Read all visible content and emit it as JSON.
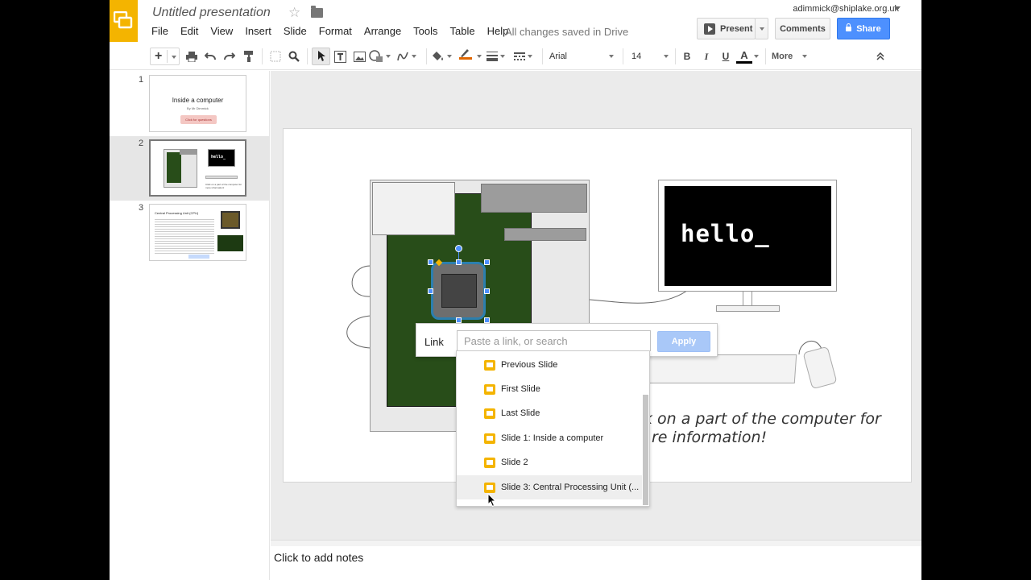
{
  "header": {
    "title": "Untitled presentation",
    "menu": [
      "File",
      "Edit",
      "View",
      "Insert",
      "Slide",
      "Format",
      "Arrange",
      "Tools",
      "Table",
      "Help"
    ],
    "save_status": "All changes saved in Drive",
    "account": "adimmick@shiplake.org.uk",
    "present_label": "Present",
    "comments_label": "Comments",
    "share_label": "Share"
  },
  "toolbar": {
    "add_label": "+",
    "font_name": "Arial",
    "font_size": "14",
    "bold": "B",
    "italic": "I",
    "underline": "U",
    "text_color": "A",
    "more_label": "More",
    "text_color_bar": "#e06600"
  },
  "filmstrip": {
    "slides": [
      {
        "number": "1",
        "title": "Inside a computer",
        "subtitle": "By Mr Dimmick",
        "button": "Click for questions"
      },
      {
        "number": "2",
        "screen_text": "hello_",
        "caption": "Click on a part of the computer for more information!"
      },
      {
        "number": "3",
        "title": "Central Processing Unit (CPU)"
      }
    ]
  },
  "slide": {
    "screen_text": "hello_",
    "hint_line1": "k on a part of the computer for",
    "hint_line2": "re information!"
  },
  "link_popup": {
    "label": "Link",
    "placeholder": "Paste a link, or search",
    "apply_label": "Apply",
    "options": [
      "Previous Slide",
      "First Slide",
      "Last Slide",
      "Slide 1: Inside a computer",
      "Slide 2",
      "Slide 3: Central Processing Unit (..."
    ]
  },
  "notes": {
    "placeholder": "Click to add notes"
  },
  "colors": {
    "brand": "#f4b400",
    "share": "#4d90fe",
    "board": "#284d19"
  }
}
